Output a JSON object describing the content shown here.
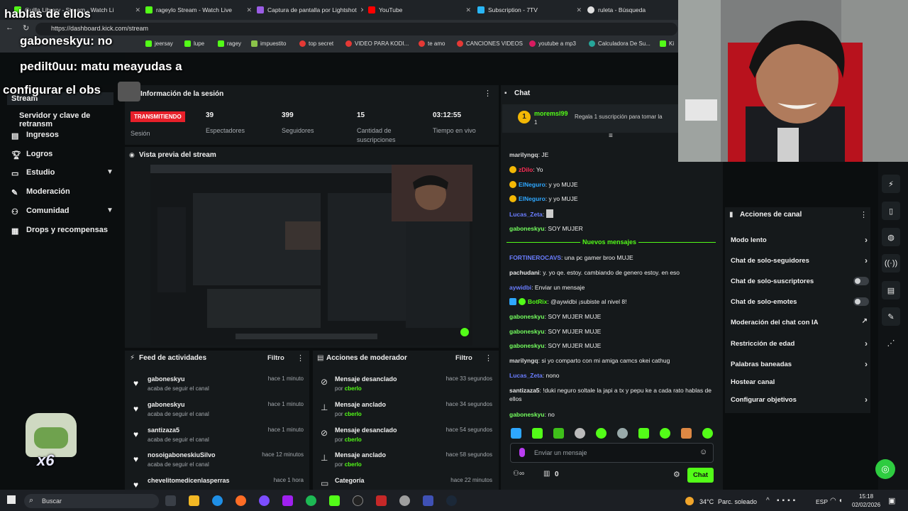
{
  "browser": {
    "tabs": [
      {
        "title": "Guilla Library - Stream - Watch Li",
        "color": "#53fc18"
      },
      {
        "title": "rageylo Stream - Watch Live",
        "color": "#53fc18"
      },
      {
        "title": "Captura de pantalla por Lightshot",
        "color": "#9b5de5"
      },
      {
        "title": "YouTube",
        "color": "#ff0000"
      },
      {
        "title": "Subscription - 7TV",
        "color": "#29b6f6"
      },
      {
        "title": "ruleta - Búsqueda",
        "color": "#e0e0e0"
      }
    ],
    "url": "https://dashboard.kick.com/stream",
    "bookmarks": [
      "jeersay",
      "lupe",
      "ragey",
      "impuestito",
      "top secret",
      "VIDEO PARA KODI...",
      "te amo",
      "CANCIONES VIDEOS",
      "youtube a mp3",
      "Calculadora De Su...",
      "Ki"
    ]
  },
  "overlay": {
    "line1": "hablas de ellos",
    "line2": "gaboneskyu: no",
    "line3": "pedilt0uu: matu meayudas a",
    "line4": "configurar el obs",
    "emote_count": "x6"
  },
  "sidebar": {
    "items": [
      {
        "label": "Stream",
        "icon": "video-icon"
      },
      {
        "label": "Servidor y clave de retransm",
        "icon": ""
      },
      {
        "label": "Ingresos",
        "icon": "dollar-icon"
      },
      {
        "label": "Logros",
        "icon": "trophy-icon"
      },
      {
        "label": "Estudio",
        "icon": "studio-icon"
      },
      {
        "label": "Moderación",
        "icon": "wrench-icon"
      },
      {
        "label": "Comunidad",
        "icon": "people-icon"
      },
      {
        "label": "Drops y recompensas",
        "icon": "gift-icon"
      }
    ]
  },
  "session": {
    "title": "Información de la sesión",
    "live_badge": "TRANSMITIENDO",
    "session_label": "Sesión",
    "stats": [
      {
        "value": "39",
        "label": "Espectadores"
      },
      {
        "value": "399",
        "label": "Seguidores"
      },
      {
        "value": "15",
        "label": "Cantidad de suscripciones"
      },
      {
        "value": "03:12:55",
        "label": "Tiempo en vivo"
      }
    ]
  },
  "preview": {
    "title": "Vista previa del stream"
  },
  "feed": {
    "title": "Feed de actividades",
    "filter": "Filtro",
    "items": [
      {
        "name": "gaboneskyu",
        "sub": "acaba de seguir el canal",
        "time": "hace 1 minuto"
      },
      {
        "name": "gaboneskyu",
        "sub": "acaba de seguir el canal",
        "time": "hace 1 minuto"
      },
      {
        "name": "santizaza5",
        "sub": "acaba de seguir el canal",
        "time": "hace 1 minuto"
      },
      {
        "name": "nosoigaboneskiuSilvo",
        "sub": "acaba de seguir el canal",
        "time": "hace 12 minutos"
      },
      {
        "name": "chevelitomedicenlasperras",
        "sub": "",
        "time": "hace 1 hora"
      }
    ]
  },
  "mod": {
    "title": "Acciones de moderador",
    "filter": "Filtro",
    "items": [
      {
        "name": "Mensaje desanclado",
        "by": "por",
        "who": "cberlo",
        "time": "hace 33 segundos",
        "icon": "unpin-icon"
      },
      {
        "name": "Mensaje anclado",
        "by": "por",
        "who": "cberlo",
        "time": "hace 34 segundos",
        "icon": "pin-icon"
      },
      {
        "name": "Mensaje desanclado",
        "by": "por",
        "who": "cberlo",
        "time": "hace 54 segundos",
        "icon": "unpin-icon"
      },
      {
        "name": "Mensaje anclado",
        "by": "por",
        "who": "cberlo",
        "time": "hace 58 segundos",
        "icon": "pin-icon"
      },
      {
        "name": "Categoría",
        "by": "",
        "who": "",
        "time": "hace 22 minutos",
        "icon": "category-icon"
      }
    ]
  },
  "chat": {
    "title": "Chat",
    "pinned_user": "moremsl99",
    "pinned_count": "1",
    "gift_text": "Regala 1 suscripción para tomar la",
    "new_messages": "Nuevos mensajes",
    "messages_before": [
      {
        "user": "marilyngq",
        "text": "JE",
        "color": "#d9d9d9"
      },
      {
        "user": "zDilo",
        "text": "Yo",
        "color": "#ff2d55"
      },
      {
        "user": "ElNeguro",
        "text": "y yo MUJE",
        "color": "#2ea7ff"
      },
      {
        "user": "ElNeguro",
        "text": "y yo MUJE",
        "color": "#2ea7ff"
      },
      {
        "user": "Lucas_Zeta",
        "text": "",
        "color": "#6a7dff"
      },
      {
        "user": "gaboneskyu",
        "text": "SOY MUJER",
        "color": "#74ff5e"
      }
    ],
    "messages_after": [
      {
        "user": "FORTINEROCAVS",
        "text": "una pc gamer broo MUJE",
        "color": "#6a7dff"
      },
      {
        "user": "pachudani",
        "text": "y. yo qe. estoy. cambiando de genero estoy. en eso",
        "color": "#e8e8e8"
      },
      {
        "user": "aywidbi",
        "text": "Enviar un mensaje",
        "color": "#6a7dff"
      },
      {
        "user": "BotRix",
        "text": "@aywidbi ¡subiste al nivel 8!",
        "color": "#53fc18"
      },
      {
        "user": "gaboneskyu",
        "text": "SOY MUJER MUJE",
        "color": "#74ff5e"
      },
      {
        "user": "gaboneskyu",
        "text": "SOY MUJER MUJE",
        "color": "#74ff5e"
      },
      {
        "user": "gaboneskyu",
        "text": "SOY MUJER MUJE",
        "color": "#74ff5e"
      },
      {
        "user": "marilyngq",
        "text": "si yo comparto con mi amiga camcs okei cathug",
        "color": "#d9d9d9"
      },
      {
        "user": "Lucas_Zeta",
        "text": "nono",
        "color": "#6a7dff"
      },
      {
        "user": "santizaza5",
        "text": "!duki neguro soltale la japi a tx y pepu ke a cada rato hablas de ellos",
        "color": "#e8e8e8"
      },
      {
        "user": "gaboneskyu",
        "text": "no",
        "color": "#74ff5e"
      }
    ],
    "input_placeholder": "Enviar un mensaje",
    "points": "0",
    "send_label": "Chat"
  },
  "actions": {
    "title": "Acciones de canal",
    "items": [
      {
        "label": "Modo lento",
        "ctrl": "chevron"
      },
      {
        "label": "Chat de solo-seguidores",
        "ctrl": "chevron"
      },
      {
        "label": "Chat de solo-suscriptores",
        "ctrl": "toggle"
      },
      {
        "label": "Chat de solo-emotes",
        "ctrl": "toggle"
      },
      {
        "label": "Moderación del chat con IA",
        "ctrl": "external"
      },
      {
        "label": "Restricción de edad",
        "ctrl": "chevron"
      },
      {
        "label": "Palabras baneadas",
        "ctrl": "chevron"
      },
      {
        "label": "Hostear canal",
        "ctrl": "none"
      },
      {
        "label": "Configurar objetivos",
        "ctrl": "chevron"
      }
    ]
  },
  "taskbar": {
    "search": "Buscar",
    "weather": "34°C",
    "weather_text": "Parc. soleado",
    "lang": "ESP",
    "time": "15:18",
    "date": "02/02/2026"
  },
  "colors": {
    "accent": "#53fc18",
    "live": "#e8202a",
    "panel": "#15191b"
  }
}
